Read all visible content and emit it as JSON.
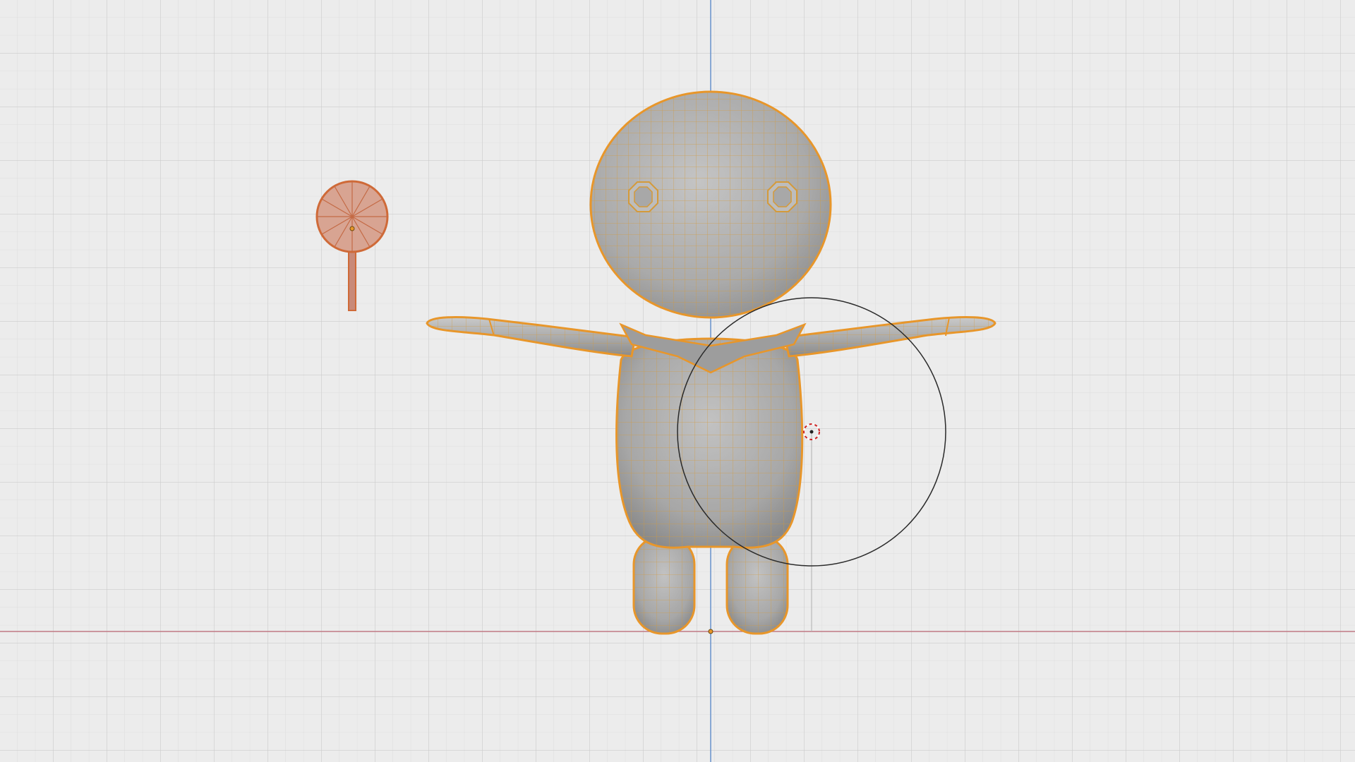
{
  "viewport": {
    "view": "front-orthographic",
    "shading": "solid-wireframe-overlay",
    "mode": "edit",
    "selection_color": "#e8962a",
    "mesh_color": "#a9a9a9",
    "grid_color": "#d6d6d6",
    "x_axis_color": "#c07a84",
    "z_axis_color": "#6f97cf"
  },
  "objects": [
    {
      "name": "character-mesh",
      "selected": true
    },
    {
      "name": "lollipop-mesh",
      "selected": true
    }
  ],
  "cursor_icon": "3d-cursor-icon",
  "brush_icon": "circle-brush-icon"
}
